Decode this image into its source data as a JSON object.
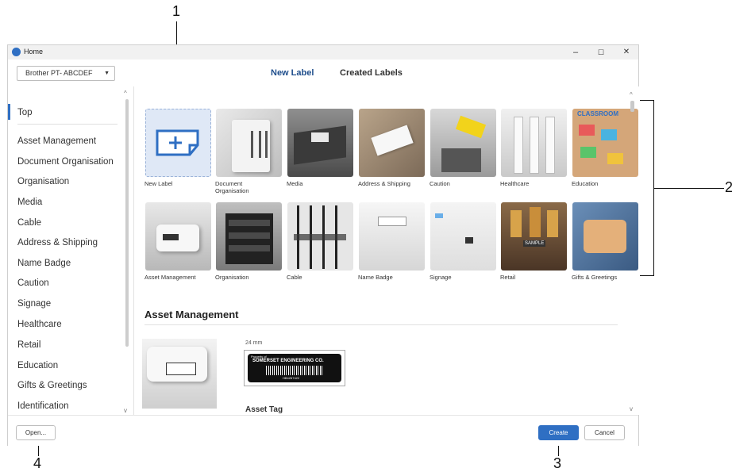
{
  "callouts": [
    "1",
    "2",
    "3",
    "4"
  ],
  "window": {
    "title": "Home"
  },
  "window_controls": {
    "minimize": "–",
    "maximize": "☐",
    "close": "✕"
  },
  "toolbar": {
    "printer": "Brother PT- ABCDEF"
  },
  "tabs": [
    {
      "label": "New Label",
      "active": true
    },
    {
      "label": "Created Labels",
      "active": false
    }
  ],
  "sidebar": {
    "items": [
      "Top",
      "Asset Management",
      "Document Organisation",
      "Organisation",
      "Media",
      "Cable",
      "Address & Shipping",
      "Name Badge",
      "Caution",
      "Signage",
      "Healthcare",
      "Retail",
      "Education",
      "Gifts & Greetings",
      "Identification"
    ]
  },
  "categories_row1": [
    "New Label",
    "Document Organisation",
    "Media",
    "Address & Shipping",
    "Caution",
    "Healthcare",
    "Education"
  ],
  "categories_row2": [
    "Asset Management",
    "Organisation",
    "Cable",
    "Name Badge",
    "Signage",
    "Retail",
    "Gifts & Greetings"
  ],
  "education_tile_text": "CLASSROOM",
  "retail_tile_text": "SAMPLE",
  "section": {
    "heading": "Asset Management",
    "tape_width": "24 mm",
    "label_property_of": "Property of",
    "label_company": "SOMERSET ENGINEERING CO.",
    "label_code": "HB4267422",
    "item_title": "Asset Tag"
  },
  "footer": {
    "open": "Open...",
    "create": "Create",
    "cancel": "Cancel"
  },
  "colors": {
    "accent": "#2f6fc3",
    "create_button": "#2f6fc3"
  }
}
